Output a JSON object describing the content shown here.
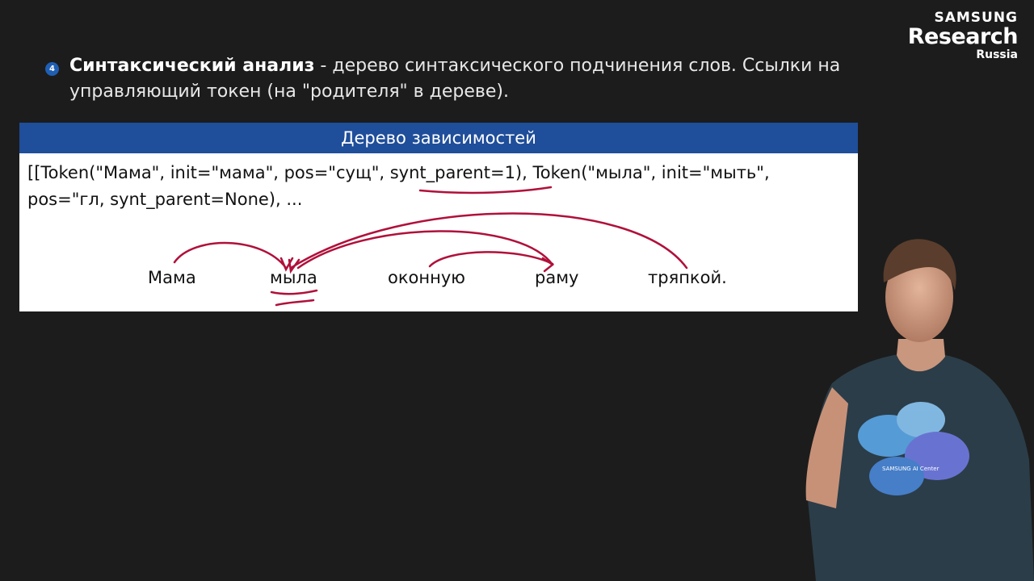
{
  "logo": {
    "line1": "SAMSUNG",
    "line2": "Research",
    "line3": "Russia"
  },
  "bullet": {
    "number": "4",
    "title": "Синтаксический анализ",
    "text": " - дерево синтаксического подчинения слов. Ссылки на управляющий токен (на \"родителя\" в дереве)."
  },
  "block": {
    "title": "Дерево зависимостей",
    "code_line1": "[[Token(\"Мама\", init=\"мама\", pos=\"сущ\", synt_parent=1), Token(\"мыла\", init=\"мыть\",",
    "code_line2": "pos=\"гл, synt_parent=None), ..."
  },
  "tree": {
    "words": [
      "Мама",
      "мыла",
      "оконную",
      "раму",
      "тряпкой."
    ]
  },
  "colors": {
    "slide_bg": "#1c1c1c",
    "block_header": "#1f4e9a",
    "annotation": "#b0103a",
    "bullet": "#1f5fb3"
  },
  "speaker": {
    "shirt_print": "SAMSUNG AI Center"
  }
}
